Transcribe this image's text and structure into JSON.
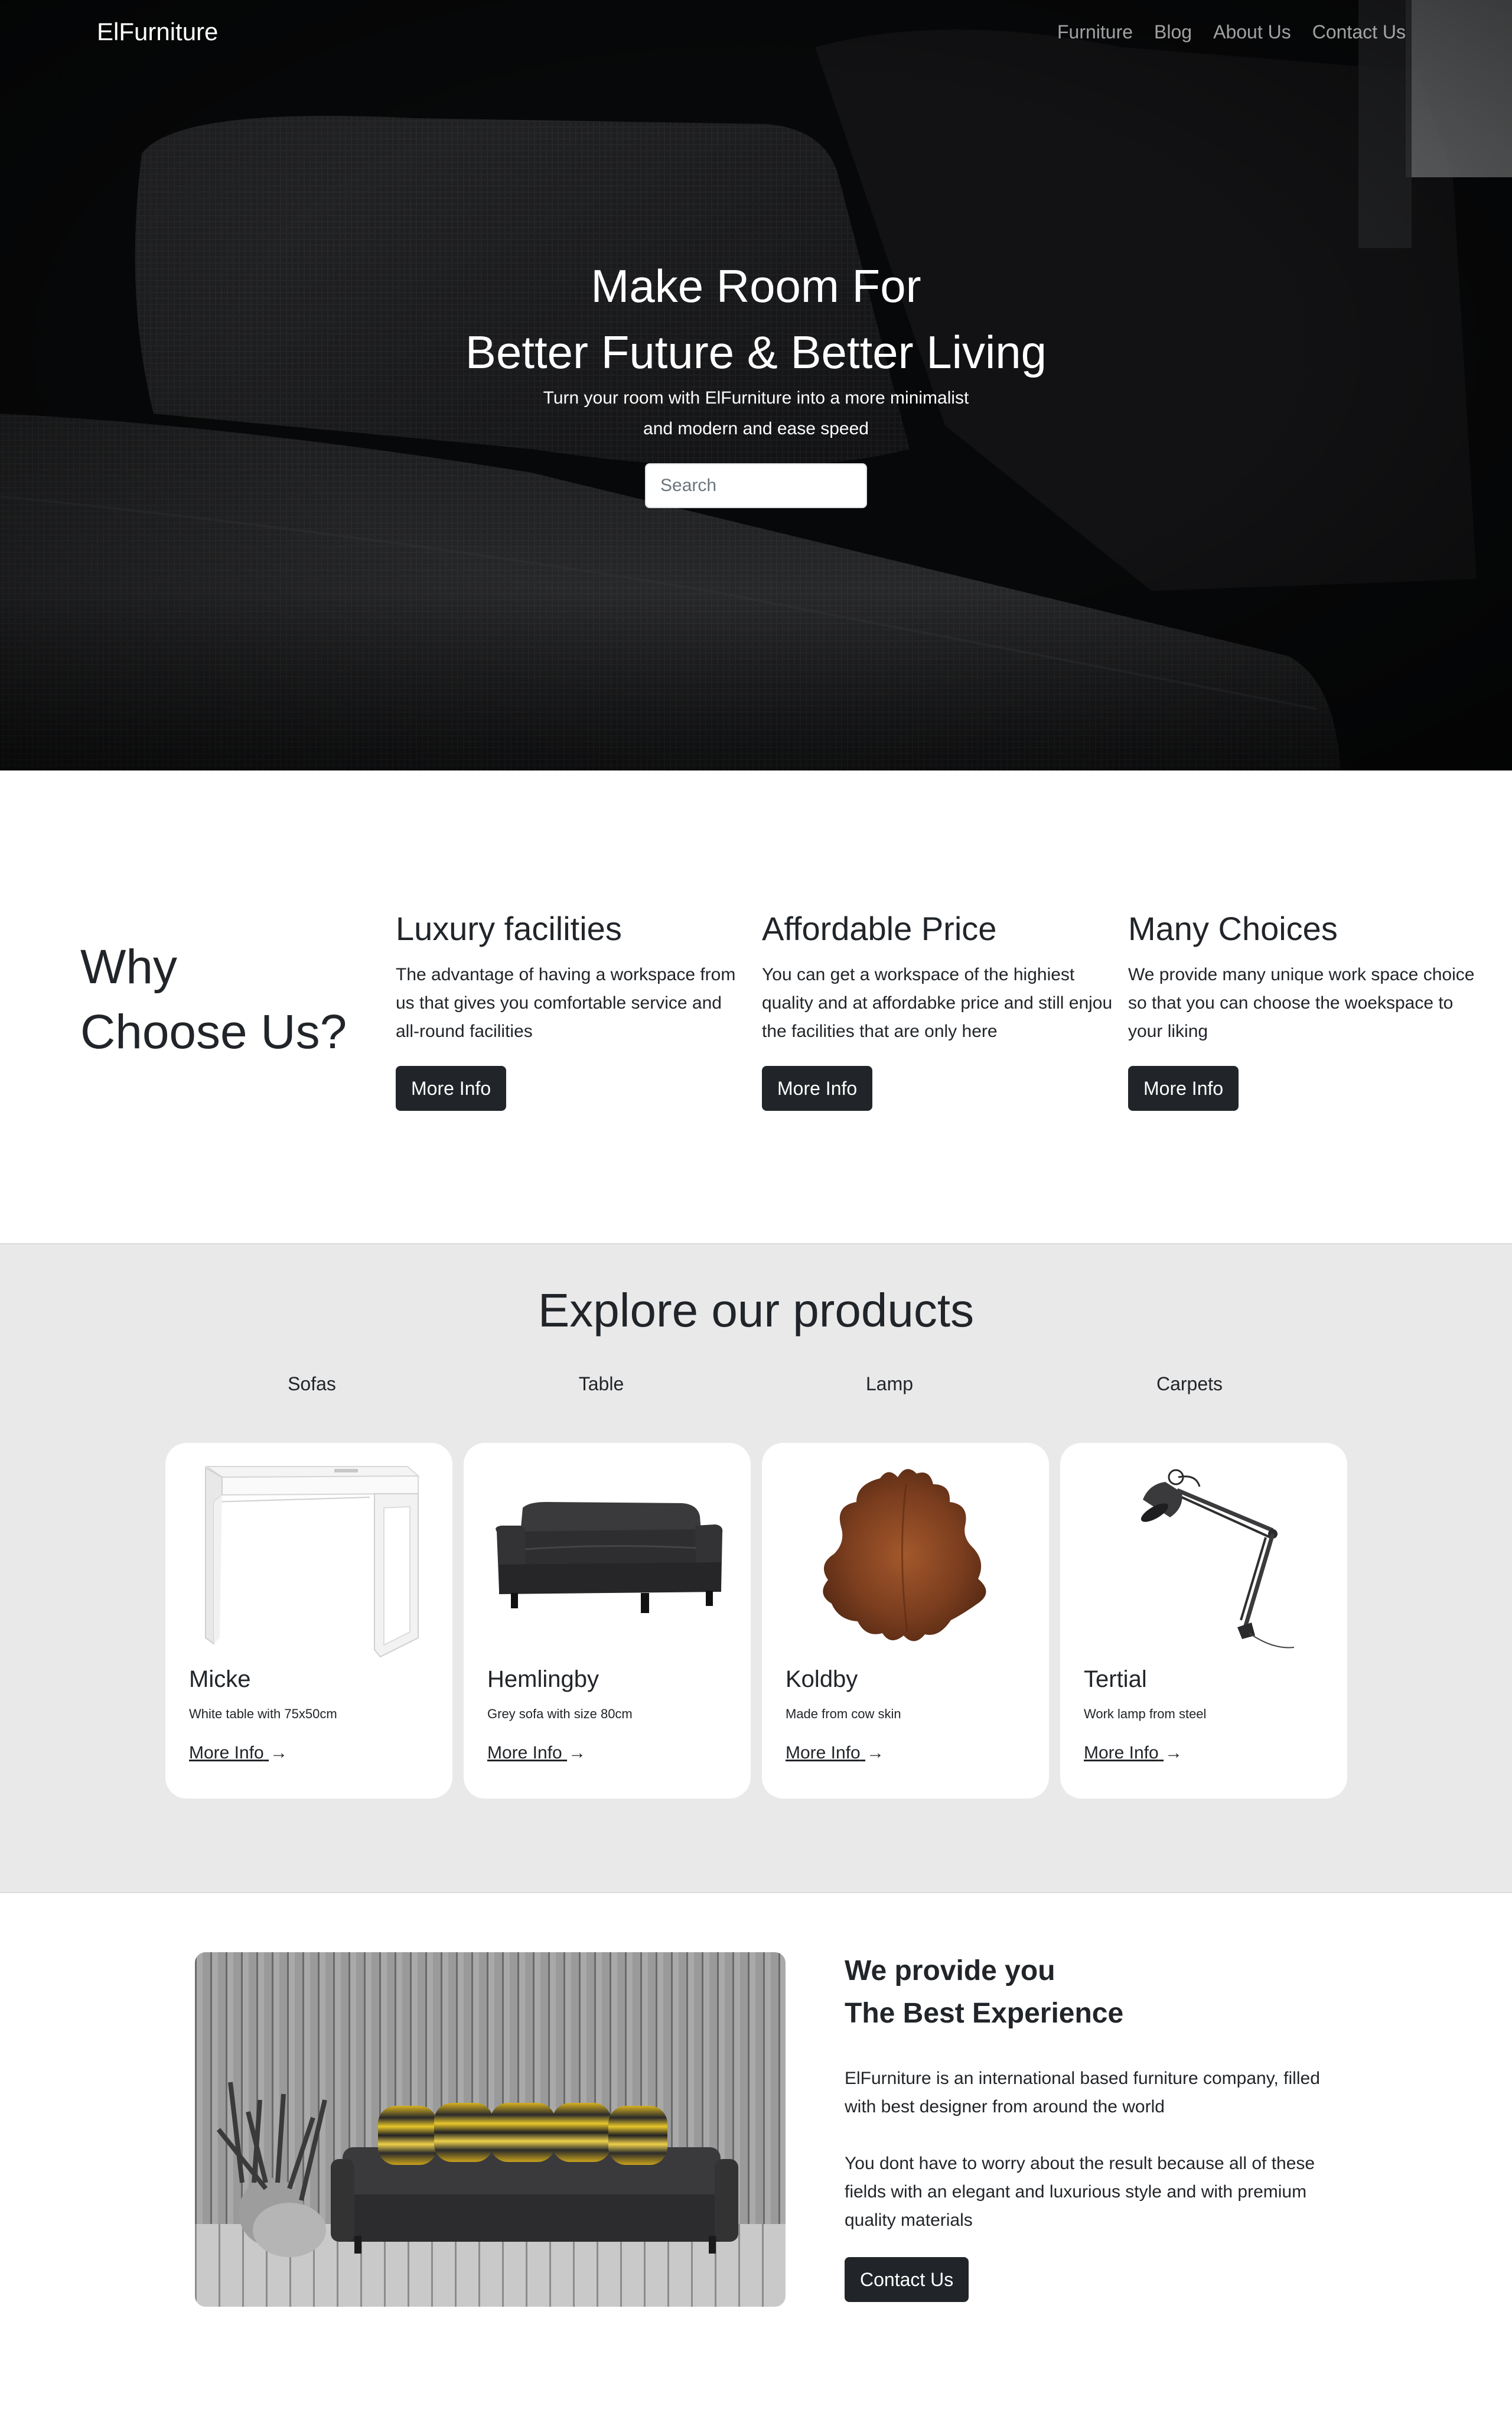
{
  "nav": {
    "brand": "ElFurniture",
    "links": [
      "Furniture",
      "Blog",
      "About Us",
      "Contact Us"
    ]
  },
  "hero": {
    "title_line1": "Make Room For",
    "title_line2": "Better Future & Better Living",
    "subtitle_line1": "Turn your room with ElFurniture into a more minimalist",
    "subtitle_line2": "and modern and ease speed",
    "search_placeholder": "Search",
    "search_value": ""
  },
  "why": {
    "title_line1": "Why",
    "title_line2": "Choose Us?",
    "features": [
      {
        "title": "Luxury facilities",
        "text": "The advantage of having a workspace from us that gives you comfortable service and all-round facilities",
        "button": "More Info"
      },
      {
        "title": "Affordable Price",
        "text": "You can get a workspace of the highiest quality and at affordabke price and still enjou the facilities that are only here",
        "button": "More Info"
      },
      {
        "title": "Many Choices",
        "text": "We provide many unique work space choice so that you can choose the woekspace to your liking",
        "button": "More Info"
      }
    ]
  },
  "products": {
    "title": "Explore our products",
    "categories": [
      "Sofas",
      "Table",
      "Lamp",
      "Carpets"
    ],
    "items": [
      {
        "name": "Micke",
        "desc": "White table with 75x50cm",
        "link": "More Info",
        "image": "white-desk"
      },
      {
        "name": "Hemlingby",
        "desc": "Grey sofa with size 80cm",
        "link": "More Info",
        "image": "grey-sofa"
      },
      {
        "name": "Koldby",
        "desc": "Made from cow skin",
        "link": "More Info",
        "image": "cowhide-rug"
      },
      {
        "name": "Tertial",
        "desc": "Work lamp from steel",
        "link": "More Info",
        "image": "desk-lamp"
      }
    ],
    "arrow_icon": "→"
  },
  "about": {
    "heading_line1": "We provide you",
    "heading_line2": "The Best Experience",
    "paragraph1": "ElFurniture is an international based furniture company, filled with best designer from around the world",
    "paragraph2": "You dont have to worry about the result because all of these fields with an elegant and luxurious style and with premium quality materials",
    "button": "Contact Us"
  },
  "colors": {
    "dark": "#212529",
    "products_bg": "#e9e9e9",
    "white": "#ffffff"
  }
}
